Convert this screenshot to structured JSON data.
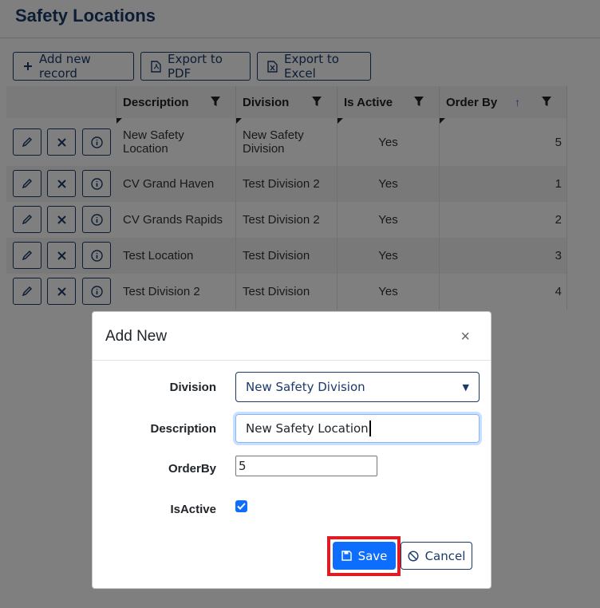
{
  "page": {
    "title": "Safety Locations"
  },
  "toolbar": {
    "add_label": "Add new record",
    "pdf_label": "Export to PDF",
    "excel_label": "Export to Excel"
  },
  "grid": {
    "columns": [
      "Description",
      "Division",
      "Is Active",
      "Order By"
    ],
    "rows": [
      {
        "description": "New Safety Location",
        "division": "New Safety Division",
        "is_active": "Yes",
        "order_by": "5"
      },
      {
        "description": "CV Grand Haven",
        "division": "Test Division 2",
        "is_active": "Yes",
        "order_by": "1"
      },
      {
        "description": "CV Grands Rapids",
        "division": "Test Division 2",
        "is_active": "Yes",
        "order_by": "2"
      },
      {
        "description": "Test Location",
        "division": "Test Division",
        "is_active": "Yes",
        "order_by": "3"
      },
      {
        "description": "Test Division 2",
        "division": "Test Division",
        "is_active": "Yes",
        "order_by": "4"
      }
    ]
  },
  "modal": {
    "title": "Add New",
    "close_symbol": "×",
    "fields": {
      "division_label": "Division",
      "division_value": "New Safety Division",
      "description_label": "Description",
      "description_value": "New Safety Location",
      "orderby_label": "OrderBy",
      "orderby_value": "5",
      "isactive_label": "IsActive",
      "isactive_checked": true
    },
    "save_label": "Save",
    "cancel_label": "Cancel"
  },
  "colors": {
    "primary": "#0d6efd",
    "navy": "#1b3a6b",
    "highlight": "#e01b24"
  },
  "icons": [
    "plus-icon",
    "pdf-file-icon",
    "excel-file-icon",
    "filter-icon",
    "sort-asc-icon",
    "edit-icon",
    "delete-icon",
    "info-icon",
    "dropdown-caret-icon",
    "checkmark-icon",
    "save-icon",
    "cancel-icon"
  ]
}
